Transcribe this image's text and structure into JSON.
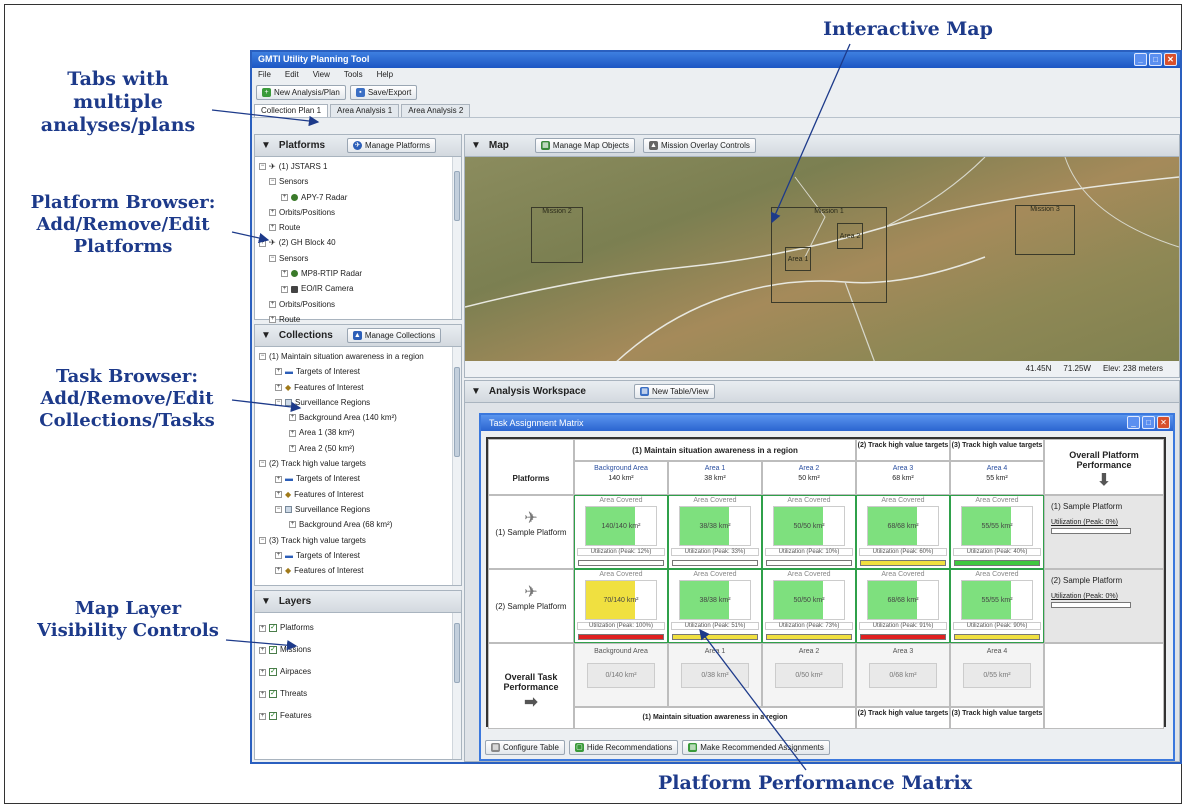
{
  "callouts": {
    "tabs": "Tabs with multiple analyses/plans",
    "platform_browser": "Platform Browser: Add/Remove/Edit Platforms",
    "task_browser": "Task Browser: Add/Remove/Edit Collections/Tasks",
    "layers": "Map Layer Visibility Controls",
    "interactive_map": "Interactive Map",
    "performance_matrix": "Platform Performance Matrix"
  },
  "app": {
    "title": "GMTI Utility Planning Tool",
    "menu": [
      "File",
      "Edit",
      "View",
      "Tools",
      "Help"
    ],
    "toolbar": {
      "new_label": "New Analysis/Plan",
      "save_label": "Save/Export"
    },
    "tabs": [
      "Collection Plan 1",
      "Area Analysis 1",
      "Area Analysis 2"
    ]
  },
  "platforms": {
    "title": "Platforms",
    "manage_label": "Manage Platforms",
    "tree": [
      {
        "label": "(1) JSTARS 1"
      },
      {
        "label": "Sensors"
      },
      {
        "label": "APY-7 Radar"
      },
      {
        "label": "Orbits/Positions"
      },
      {
        "label": "Route"
      },
      {
        "label": "(2) GH Block 40"
      },
      {
        "label": "Sensors"
      },
      {
        "label": "MP8-RTIP Radar"
      },
      {
        "label": "EO/IR Camera"
      },
      {
        "label": "Orbits/Positions"
      },
      {
        "label": "Route"
      }
    ]
  },
  "collections": {
    "title": "Collections",
    "manage_label": "Manage Collections",
    "tree": [
      {
        "label": "(1) Maintain situation awareness in a region"
      },
      {
        "label": "Targets of Interest"
      },
      {
        "label": "Features of Interest"
      },
      {
        "label": "Surveillance Regions"
      },
      {
        "label": "Background Area (140 km²)"
      },
      {
        "label": "Area 1 (38 km²)"
      },
      {
        "label": "Area 2 (50 km²)"
      },
      {
        "label": "(2) Track high value targets"
      },
      {
        "label": "Targets of Interest"
      },
      {
        "label": "Features of Interest"
      },
      {
        "label": "Surveillance Regions"
      },
      {
        "label": "Background Area (68 km²)"
      },
      {
        "label": "(3) Track high value targets"
      },
      {
        "label": "Targets of Interest"
      },
      {
        "label": "Features of Interest"
      }
    ]
  },
  "layers": {
    "title": "Layers",
    "items": [
      "Platforms",
      "Missions",
      "Airpaces",
      "Threats",
      "Features"
    ]
  },
  "map": {
    "title": "Map",
    "manage_objects_label": "Manage Map Objects",
    "overlay_label": "Mission Overlay Controls",
    "missions": [
      "Mission 2",
      "Mission 1",
      "Mission 3"
    ],
    "areas": [
      "Area 1",
      "Area 2"
    ],
    "status": {
      "lat": "41.45N",
      "lon": "71.25W",
      "elev": "Elev: 238 meters"
    }
  },
  "workspace": {
    "title": "Analysis Workspace",
    "new_table_label": "New Table/View",
    "tam_title": "Task Assignment Matrix",
    "platforms_header": "Platforms",
    "overall_platform": "Overall Platform Performance",
    "overall_task": "Overall Task Performance",
    "task_group_1": "(1) Maintain situation awareness in a region",
    "task_group_2": "(2) Track high value targets",
    "task_group_3": "(3) Track high value targets",
    "columns": [
      {
        "name": "Background Area",
        "size": "140 km²"
      },
      {
        "name": "Area 1",
        "size": "38 km²"
      },
      {
        "name": "Area 2",
        "size": "50 km²"
      },
      {
        "name": "Area 3",
        "size": "68 km²"
      },
      {
        "name": "Area 4",
        "size": "55 km²"
      }
    ],
    "rows": [
      {
        "platform": "(1) Sample Platform",
        "cells": [
          {
            "covered": "140/140 km²",
            "util": "Utilization (Peak: 12%)",
            "color": "#7ee07e",
            "bar": "#ffffff"
          },
          {
            "covered": "38/38 km²",
            "util": "Utilization (Peak: 33%)",
            "color": "#7ee07e",
            "bar": "#ffffff"
          },
          {
            "covered": "50/50 km²",
            "util": "Utilization (Peak: 10%)",
            "color": "#7ee07e",
            "bar": "#ffffff"
          },
          {
            "covered": "68/68 km²",
            "util": "Utilization (Peak: 60%)",
            "color": "#7ee07e",
            "bar": "#f0e040"
          },
          {
            "covered": "55/55 km²",
            "util": "Utilization (Peak: 40%)",
            "color": "#7ee07e",
            "bar": "#3fc83f"
          }
        ],
        "overall": {
          "label": "(1) Sample Platform",
          "util": "Utilization (Peak: 0%)"
        }
      },
      {
        "platform": "(2) Sample Platform",
        "cells": [
          {
            "covered": "70/140 km²",
            "util": "Utilization (Peak: 100%)",
            "color": "#f0e040",
            "bar": "#e02020"
          },
          {
            "covered": "38/38 km²",
            "util": "Utilization (Peak: 51%)",
            "color": "#7ee07e",
            "bar": "#f0e040"
          },
          {
            "covered": "50/50 km²",
            "util": "Utilization (Peak: 73%)",
            "color": "#7ee07e",
            "bar": "#f0e040"
          },
          {
            "covered": "68/68 km²",
            "util": "Utilization (Peak: 91%)",
            "color": "#7ee07e",
            "bar": "#e02020"
          },
          {
            "covered": "55/55 km²",
            "util": "Utilization (Peak: 90%)",
            "color": "#7ee07e",
            "bar": "#f0e040"
          }
        ],
        "overall": {
          "label": "(2) Sample Platform",
          "util": "Utilization (Peak: 0%)"
        }
      }
    ],
    "overall_cells": [
      "0/140 km²",
      "0/38 km²",
      "0/50 km²",
      "0/68 km²",
      "0/55 km²"
    ],
    "area_covered_label": "Area Covered",
    "bottom": {
      "configure": "Configure Table",
      "hide": "Hide Recommendations",
      "make": "Make Recommended Assignments"
    }
  },
  "colors": {
    "accent": "#1d3a8a",
    "titlebar": "#1c56c3"
  }
}
